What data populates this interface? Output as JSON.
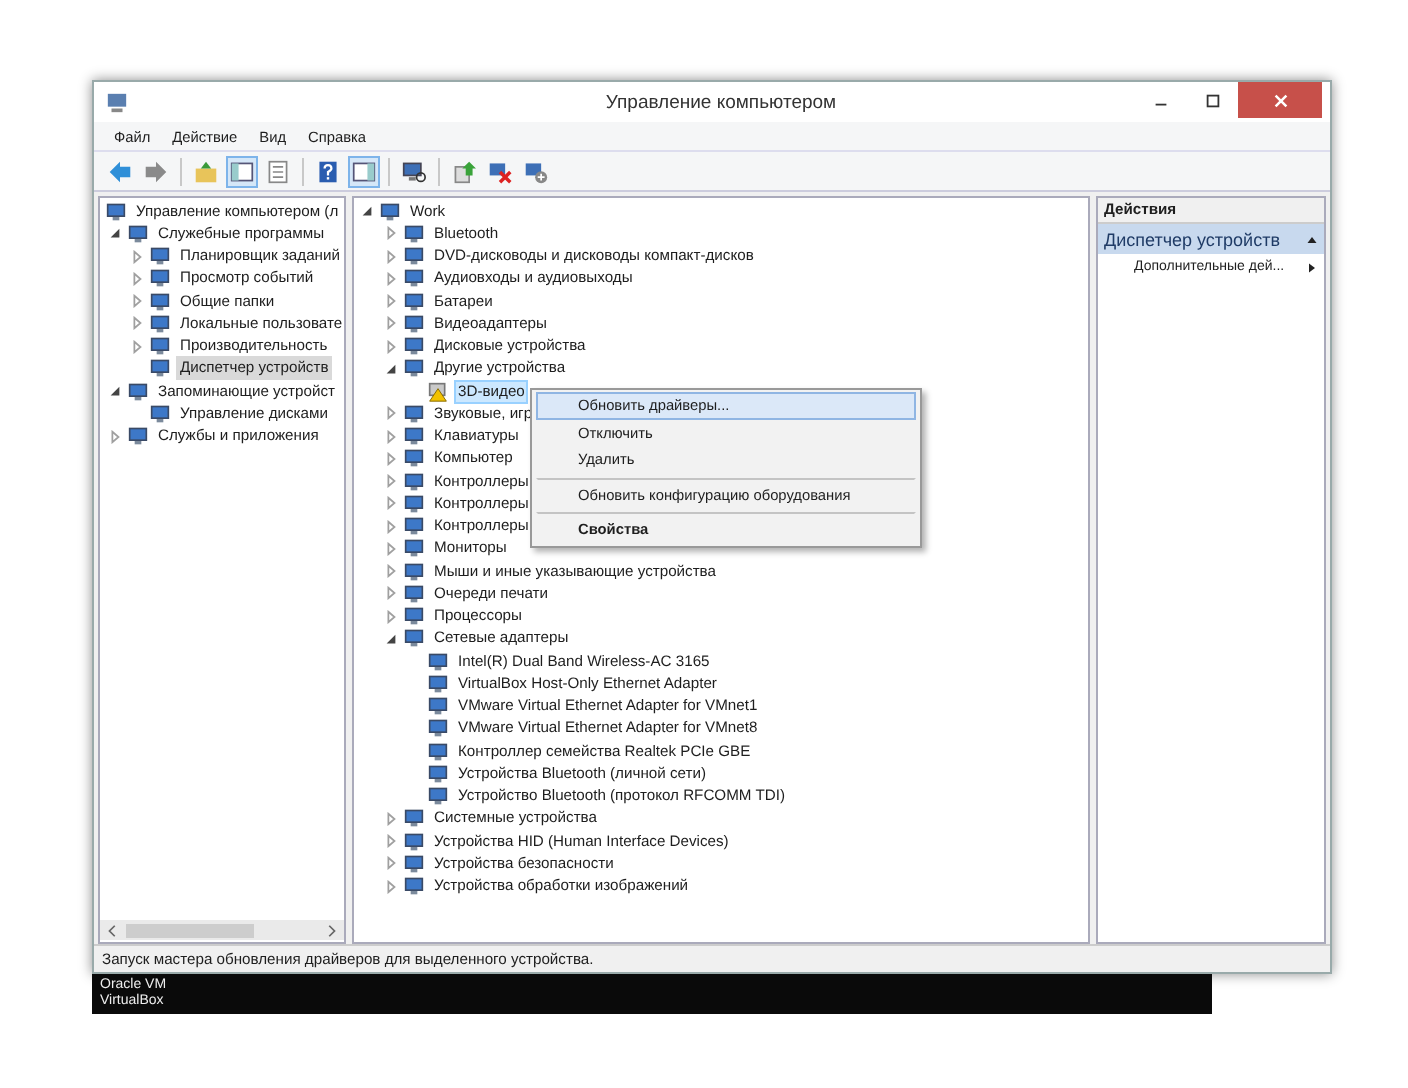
{
  "window": {
    "title": "Управление компьютером"
  },
  "menu": [
    "Файл",
    "Действие",
    "Вид",
    "Справка"
  ],
  "toolbar": [
    {
      "kind": "back",
      "pressed": false
    },
    {
      "kind": "forward",
      "pressed": false
    },
    {
      "kind": "up",
      "pressed": false
    },
    {
      "kind": "console",
      "pressed": true
    },
    {
      "kind": "properties",
      "pressed": false
    },
    {
      "kind": "help",
      "pressed": false
    },
    {
      "kind": "view",
      "pressed": true
    },
    {
      "kind": "scan",
      "pressed": false
    },
    {
      "kind": "update",
      "pressed": false
    },
    {
      "kind": "remove",
      "pressed": false
    },
    {
      "kind": "add",
      "pressed": false
    }
  ],
  "navigation_tree": [
    {
      "label": "Управление компьютером (л",
      "selected": false,
      "children": [
        {
          "label": "Служебные программы",
          "expanded": true,
          "selected": false,
          "children": [
            {
              "label": "Планировщик заданий",
              "expanded": false,
              "selected": false
            },
            {
              "label": "Просмотр событий",
              "expanded": false,
              "selected": false
            },
            {
              "label": "Общие папки",
              "expanded": false,
              "selected": false
            },
            {
              "label": "Локальные пользовате",
              "expanded": false,
              "selected": false
            },
            {
              "label": "Производительность",
              "expanded": false,
              "selected": false
            },
            {
              "label": "Диспетчер устройств",
              "selected": true
            }
          ]
        },
        {
          "label": "Запоминающие устройст",
          "expanded": true,
          "selected": false,
          "children": [
            {
              "label": "Управление дисками",
              "selected": false
            }
          ]
        },
        {
          "label": "Службы и приложения",
          "expanded": false,
          "selected": false
        }
      ]
    }
  ],
  "device_tree": [
    {
      "label": "Work",
      "expanded": true,
      "selected": false,
      "children": [
        {
          "label": "Bluetooth",
          "expanded": false,
          "selected": false
        },
        {
          "label": "DVD-дисководы и дисководы компакт-дисков",
          "expanded": false,
          "selected": false
        },
        {
          "label": "Аудиовходы и аудиовыходы",
          "expanded": false,
          "selected": false
        },
        {
          "label": "Батареи",
          "expanded": false,
          "selected": false
        },
        {
          "label": "Видеоадаптеры",
          "expanded": false,
          "selected": false
        },
        {
          "label": "Дисковые устройства",
          "expanded": false,
          "selected": false
        },
        {
          "label": "Другие устройства",
          "expanded": true,
          "selected": false,
          "children": [
            {
              "label": "3D-видео",
              "selected": true,
              "warning": true
            }
          ]
        },
        {
          "label": "Звуковые, игр",
          "expanded": false,
          "selected": false
        },
        {
          "label": "Клавиатуры",
          "expanded": false,
          "selected": false
        },
        {
          "label": "Компьютер",
          "expanded": false,
          "selected": false
        },
        {
          "label": "Контроллеры",
          "expanded": false,
          "selected": false
        },
        {
          "label": "Контроллеры",
          "expanded": false,
          "selected": false
        },
        {
          "label": "Контроллеры",
          "expanded": false,
          "selected": false
        },
        {
          "label": "Мониторы",
          "expanded": false,
          "selected": false
        },
        {
          "label": "Мыши и иные указывающие устройства",
          "expanded": false,
          "selected": false
        },
        {
          "label": "Очереди печати",
          "expanded": false,
          "selected": false
        },
        {
          "label": "Процессоры",
          "expanded": false,
          "selected": false
        },
        {
          "label": "Сетевые адаптеры",
          "expanded": true,
          "selected": false,
          "children": [
            {
              "label": "Intel(R) Dual Band Wireless-AC 3165",
              "selected": false
            },
            {
              "label": "VirtualBox Host-Only Ethernet Adapter",
              "selected": false
            },
            {
              "label": "VMware Virtual Ethernet Adapter for VMnet1",
              "selected": false
            },
            {
              "label": "VMware Virtual Ethernet Adapter for VMnet8",
              "selected": false
            },
            {
              "label": "Контроллер семейства Realtek PCIe GBE",
              "selected": false
            },
            {
              "label": "Устройства Bluetooth (личной сети)",
              "selected": false
            },
            {
              "label": "Устройство Bluetooth (протокол RFCOMM TDI)",
              "selected": false
            }
          ]
        },
        {
          "label": "Системные устройства",
          "expanded": false,
          "selected": false
        },
        {
          "label": "Устройства HID (Human Interface Devices)",
          "expanded": false,
          "selected": false
        },
        {
          "label": "Устройства безопасности",
          "expanded": false,
          "selected": false
        },
        {
          "label": "Устройства обработки изображений",
          "expanded": false,
          "selected": false
        }
      ]
    }
  ],
  "context_menu": [
    {
      "label": "Обновить драйверы...",
      "selected": true,
      "bold": false,
      "separator_before": false
    },
    {
      "label": "Отключить",
      "selected": false,
      "bold": false,
      "separator_before": false
    },
    {
      "label": "Удалить",
      "selected": false,
      "bold": false,
      "separator_before": false
    },
    {
      "label": "Обновить конфигурацию оборудования",
      "selected": false,
      "bold": false,
      "separator_before": true
    },
    {
      "label": "Свойства",
      "selected": false,
      "bold": true,
      "separator_before": true
    }
  ],
  "actions": {
    "header": "Действия",
    "section": "Диспетчер устройств",
    "items": [
      "Дополнительные дей..."
    ]
  },
  "status_bar": "Запуск мастера обновления драйверов для выделенного устройства.",
  "taskbar": [
    "Oracle VM",
    "VirtualBox"
  ]
}
